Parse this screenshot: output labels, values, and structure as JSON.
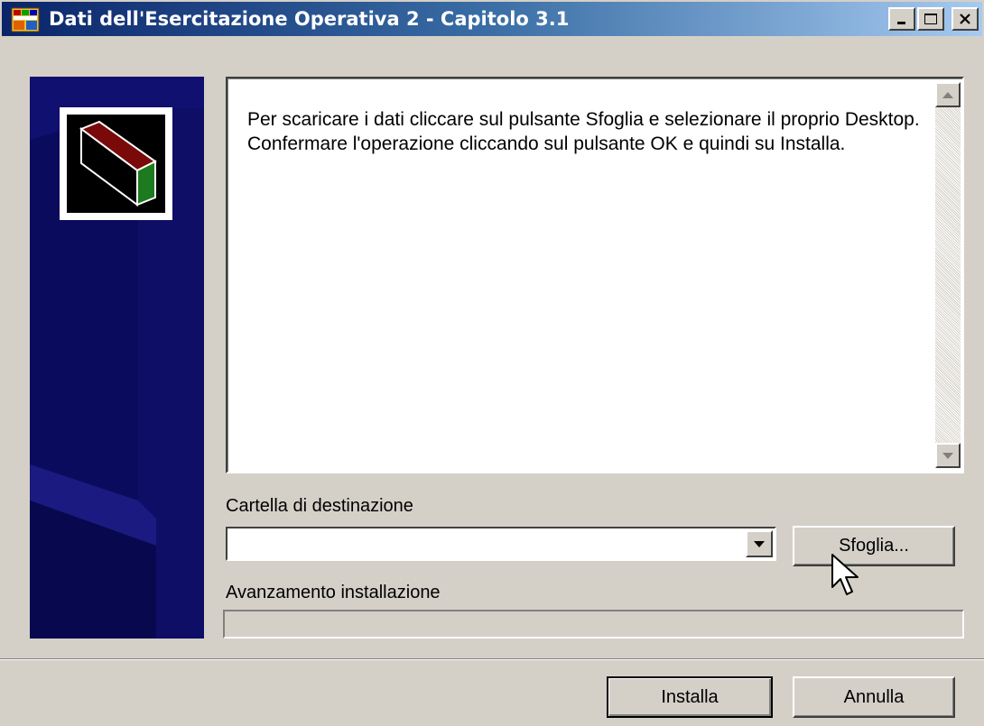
{
  "window": {
    "title": "Dati dell'Esercitazione Operativa 2 - Capitolo 3.1",
    "icons": {
      "app": "installer-app-icon",
      "minimize": "minimize-icon",
      "maximize": "maximize-icon",
      "close": "close-icon"
    }
  },
  "banner": {
    "logo_icon": "box-package-icon",
    "background_color": "#0b0b5e"
  },
  "instructions": {
    "text": "Per scaricare i dati cliccare sul pulsante Sfoglia e selezionare il proprio Desktop. Confermare l'operazione cliccando sul pulsante OK e quindi su Installa."
  },
  "destination": {
    "label": "Cartella di destinazione",
    "value": "",
    "browse_label": "Sfoglia..."
  },
  "progress": {
    "label": "Avanzamento installazione",
    "value": 0
  },
  "footer": {
    "install_label": "Installa",
    "cancel_label": "Annulla"
  },
  "colors": {
    "face": "#d4d0c8",
    "title_start": "#0a246a",
    "title_end": "#a6caf0"
  }
}
